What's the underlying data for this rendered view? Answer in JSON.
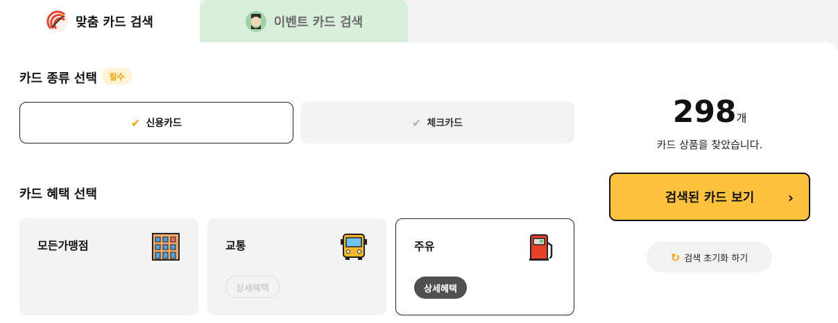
{
  "tabs": {
    "match_label": "맞춤 카드 검색",
    "event_label": "이벤트 카드 검색"
  },
  "card_type": {
    "title": "카드 종류 선택",
    "required_badge": "필수",
    "options": [
      {
        "label": "신용카드",
        "selected": true
      },
      {
        "label": "체크카드",
        "selected": false
      }
    ]
  },
  "benefits": {
    "title": "카드 혜택 선택",
    "items": [
      {
        "label": "모든가맹점",
        "icon": "building-icon"
      },
      {
        "label": "교통",
        "icon": "bus-icon",
        "detail": "상세혜택"
      },
      {
        "label": "주유",
        "icon": "fuel-pump-icon",
        "detail": "상세혜택",
        "selected": true
      }
    ]
  },
  "result": {
    "count": "298",
    "unit": "개",
    "subtitle": "카드 상품을 찾았습니다.",
    "view_button": "검색된 카드 보기",
    "reset_button": "검색 초기화 하기"
  },
  "colors": {
    "accent": "#ffc23d",
    "event_tab_bg": "#d9efdc",
    "check_orange": "#f5a300"
  }
}
